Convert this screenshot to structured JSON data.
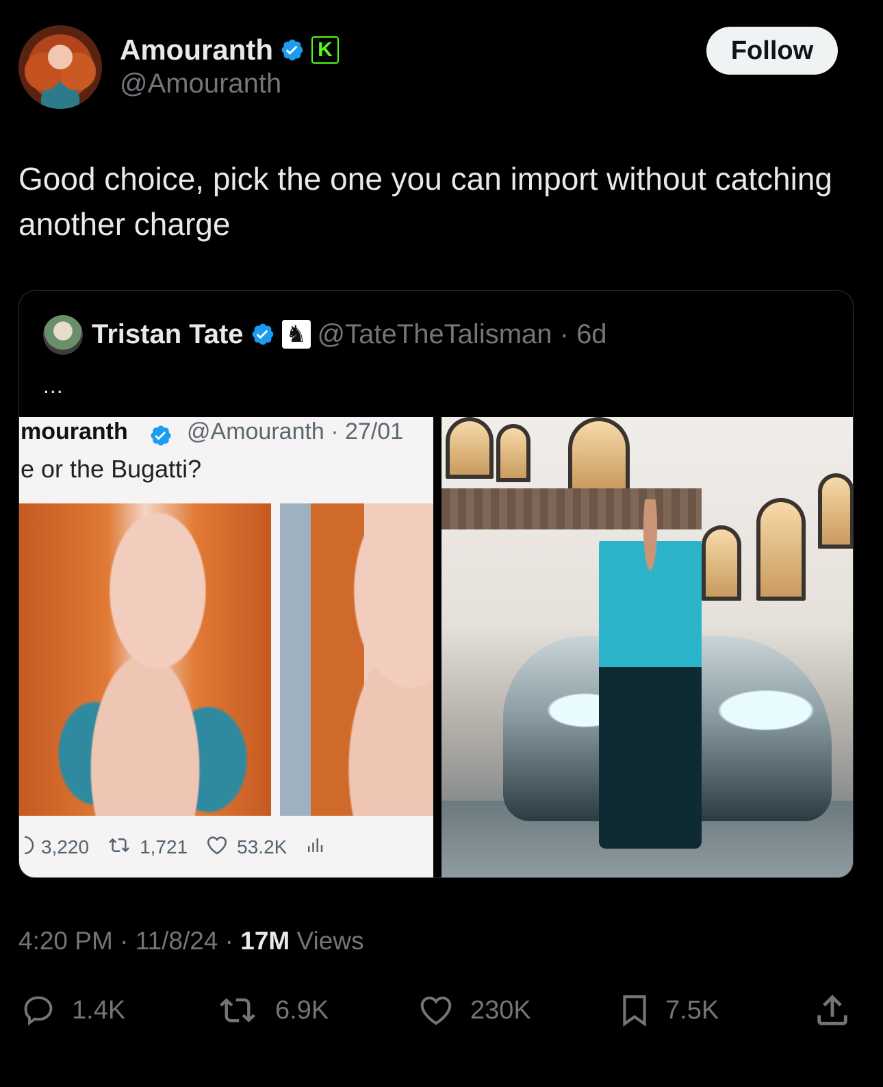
{
  "author": {
    "display_name": "Amouranth",
    "handle": "@Amouranth",
    "badges": [
      "verified-icon",
      "kick-icon"
    ]
  },
  "follow_button": {
    "label": "Follow"
  },
  "tweet": {
    "text": "Good choice, pick the one you can import without catching another charge"
  },
  "quoted_tweet": {
    "display_name": "Tristan Tate",
    "handle_and_time": "@TateTheTalisman · 6d",
    "badges": [
      "verified-icon",
      "chess-knight-icon"
    ],
    "ellipsis": "...",
    "screenshot": {
      "name": "mouranth",
      "handle": "@Amouranth · 27/01",
      "text": "e or the Bugatti?",
      "stats": {
        "replies": "3,220",
        "reposts": "1,721",
        "likes": "53.2K"
      }
    }
  },
  "meta": {
    "time": "4:20 PM",
    "date": "11/8/24",
    "views_count": "17M",
    "views_label": "Views"
  },
  "actions": {
    "replies": "1.4K",
    "reposts": "6.9K",
    "likes": "230K",
    "bookmarks": "7.5K"
  },
  "colors": {
    "background": "#000000",
    "text": "#e7e9ea",
    "secondary": "#71767b",
    "verified": "#1d9bf0",
    "kick": "#53fc18"
  }
}
